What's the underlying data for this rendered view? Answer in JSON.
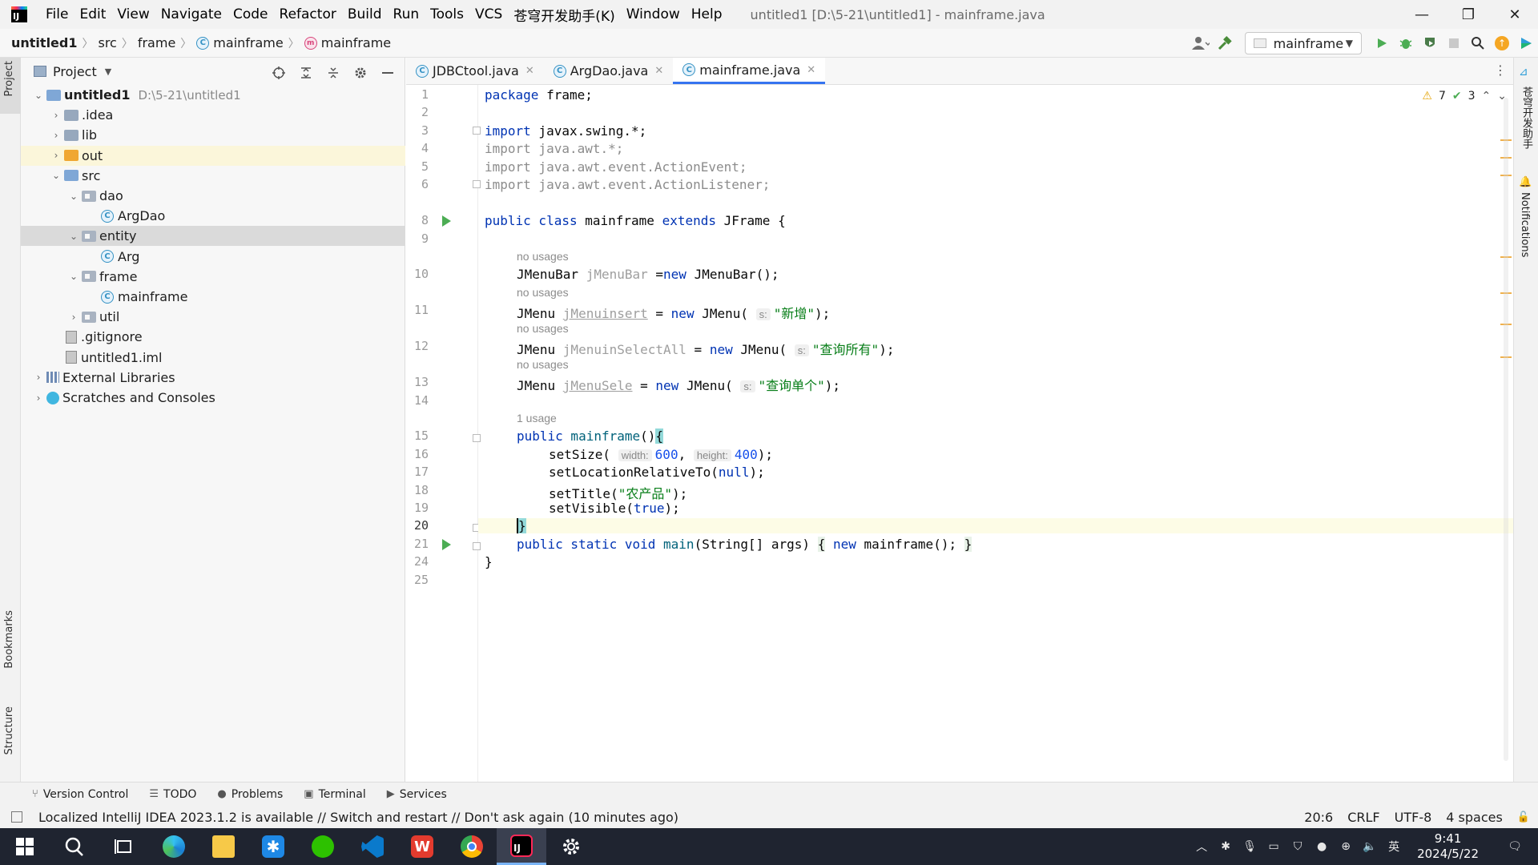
{
  "window": {
    "menu": [
      "File",
      "Edit",
      "View",
      "Navigate",
      "Code",
      "Refactor",
      "Build",
      "Run",
      "Tools",
      "VCS",
      "苍穹开发助手(K)",
      "Window",
      "Help"
    ],
    "title": "untitled1 [D:\\5-21\\untitled1] - mainframe.java",
    "minimize": "—",
    "restore": "❐",
    "close": "✕"
  },
  "breadcrumb": [
    "untitled1",
    "src",
    "frame",
    "mainframe",
    "mainframe"
  ],
  "run_config": "mainframe",
  "project_panel": {
    "title": "Project",
    "tree": [
      {
        "label": "untitled1",
        "hint": "D:\\5-21\\untitled1",
        "arrow": "⌄",
        "icon": "folder-blue"
      },
      {
        "label": ".idea",
        "arrow": "›",
        "icon": "folder"
      },
      {
        "label": "lib",
        "arrow": "›",
        "icon": "folder"
      },
      {
        "label": "out",
        "arrow": "›",
        "icon": "folder-orange"
      },
      {
        "label": "src",
        "arrow": "⌄",
        "icon": "folder-blue"
      },
      {
        "label": "dao",
        "arrow": "⌄",
        "icon": "package"
      },
      {
        "label": "ArgDao",
        "arrow": "",
        "icon": "class"
      },
      {
        "label": "entity",
        "arrow": "⌄",
        "icon": "package"
      },
      {
        "label": "Arg",
        "arrow": "",
        "icon": "class"
      },
      {
        "label": "frame",
        "arrow": "⌄",
        "icon": "package"
      },
      {
        "label": "mainframe",
        "arrow": "",
        "icon": "class"
      },
      {
        "label": "util",
        "arrow": "›",
        "icon": "package"
      },
      {
        "label": ".gitignore",
        "arrow": "",
        "icon": "file"
      },
      {
        "label": "untitled1.iml",
        "arrow": "",
        "icon": "file"
      },
      {
        "label": "External Libraries",
        "arrow": "›",
        "icon": "library"
      },
      {
        "label": "Scratches and Consoles",
        "arrow": "›",
        "icon": "scratch"
      }
    ]
  },
  "tabs": [
    {
      "label": "JDBCtool.java"
    },
    {
      "label": "ArgDao.java"
    },
    {
      "label": "mainframe.java"
    }
  ],
  "inspections": {
    "warnings": "7",
    "checks": "3"
  },
  "editor": {
    "line_numbers": [
      "1",
      "2",
      "3",
      "4",
      "5",
      "6",
      "8",
      "9",
      "10",
      "11",
      "12",
      "13",
      "14",
      "15",
      "16",
      "17",
      "18",
      "19",
      "20",
      "21",
      "24",
      "25"
    ],
    "hints": {
      "no_usages": "no usages",
      "one_usage": "1 usage"
    },
    "code": {
      "l1_kw": "package",
      "l1_rest": " frame;",
      "l3_kw": "import",
      "l3_rest": " javax.swing.*;",
      "l4": "import java.awt.*;",
      "l5": "import java.awt.event.ActionEvent;",
      "l6": "import java.awt.event.ActionListener;",
      "l8_kw1": "public class",
      "l8_mid": " mainframe ",
      "l8_kw2": "extends",
      "l8_rest": " JFrame {",
      "l10_type": "JMenuBar ",
      "l10_field": "jMenuBar",
      "l10_eq": " =",
      "l10_new": "new",
      "l10_rest": " JMenuBar();",
      "l11_type": "JMenu ",
      "l11_field": "jMenuinsert",
      "l11_eq": " = ",
      "l11_new": "new",
      "l11_call": " JMenu( ",
      "l11_hint": "s:",
      "l11_str": "\"新增\"",
      "l11_end": ");",
      "l12_type": "JMenu ",
      "l12_field": "jMenuinSelectAll",
      "l12_eq": " = ",
      "l12_new": "new",
      "l12_call": " JMenu( ",
      "l12_hint": "s:",
      "l12_str": "\"查询所有\"",
      "l12_end": ");",
      "l13_type": "JMenu ",
      "l13_field": "jMenuSele",
      "l13_eq": " = ",
      "l13_new": "new",
      "l13_call": " JMenu( ",
      "l13_hint": "s:",
      "l13_str": "\"查询单个\"",
      "l13_end": ");",
      "l15_kw": "public",
      "l15_meth": " mainframe",
      "l15_parens": "()",
      "l15_brace": "{",
      "l16_call": "setSize( ",
      "l16_hint1": "width:",
      "l16_n1": "600",
      "l16_sep": ", ",
      "l16_hint2": "height:",
      "l16_n2": "400",
      "l16_end": ");",
      "l17_call": "setLocationRelativeTo(",
      "l17_kw": "null",
      "l17_end": ");",
      "l18_call": "setTitle(",
      "l18_str": "\"农产品\"",
      "l18_end": ");",
      "l19_call": "setVisible(",
      "l19_kw": "true",
      "l19_end": ");",
      "l20": "}",
      "l21_kw": "public static void",
      "l21_meth": " main",
      "l21_args": "(String[] args) ",
      "l21_b1": "{",
      "l21_new": " new",
      "l21_rest": " mainframe(); ",
      "l21_b2": "}",
      "l24": "}"
    }
  },
  "tool_windows": [
    "Version Control",
    "TODO",
    "Problems",
    "Terminal",
    "Services"
  ],
  "left_strip": {
    "project": "Project",
    "bookmarks": "Bookmarks",
    "structure": "Structure"
  },
  "right_strip": {
    "assistant": "苍穹开发助手",
    "notifications": "Notifications"
  },
  "status": {
    "message": "Localized IntelliJ IDEA 2023.1.2 is available // Switch and restart // Don't ask again (10 minutes ago)",
    "position": "20:6",
    "line_sep": "CRLF",
    "encoding": "UTF-8",
    "indent": "4 spaces"
  },
  "taskbar": {
    "ime": "英",
    "time": "9:41",
    "date": "2024/5/22"
  },
  "colors": {
    "accent": "#3574f0",
    "keyword": "#0033b3",
    "string": "#067d17",
    "number": "#1750eb",
    "run": "#4cad54"
  }
}
